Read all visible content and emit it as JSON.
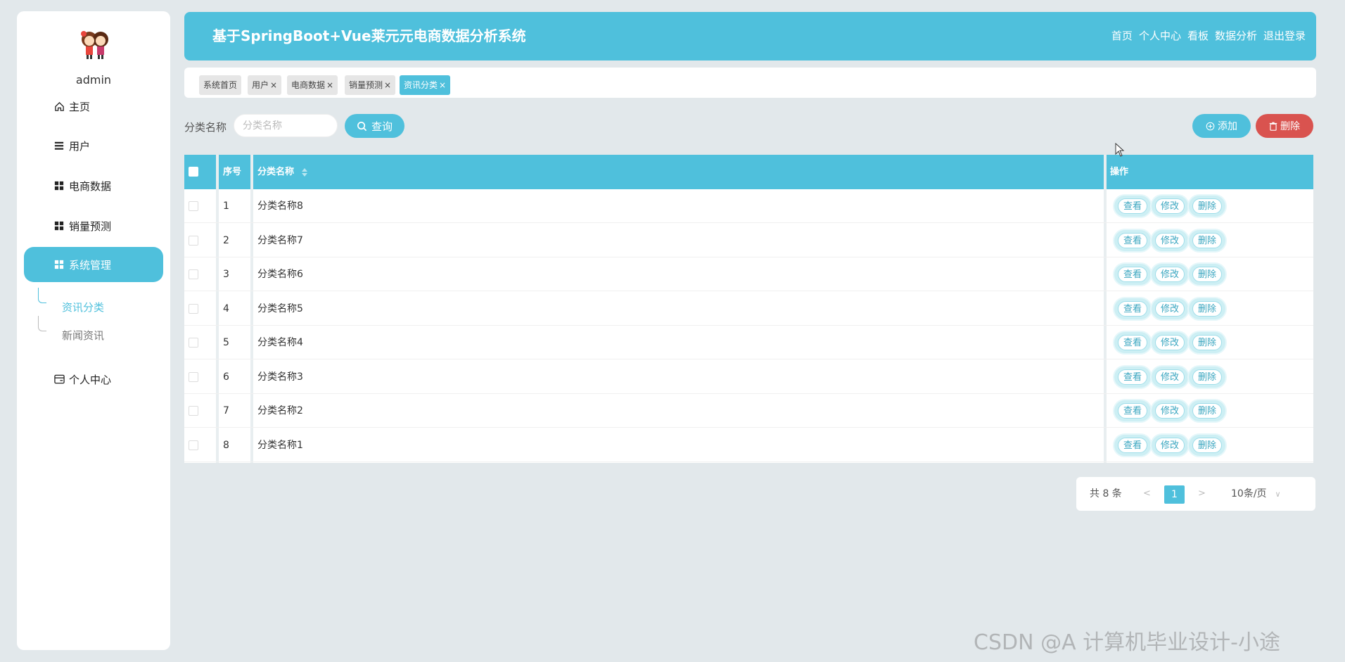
{
  "user": {
    "name": "admin"
  },
  "sidebar": {
    "items": [
      {
        "label": "主页",
        "icon": "home-icon"
      },
      {
        "label": "用户",
        "icon": "list-icon"
      },
      {
        "label": "电商数据",
        "icon": "grid-icon"
      },
      {
        "label": "销量预测",
        "icon": "grid-icon"
      },
      {
        "label": "系统管理",
        "icon": "grid-icon",
        "active": true
      },
      {
        "label": "个人中心",
        "icon": "card-icon"
      }
    ],
    "subitems": [
      {
        "label": "资讯分类",
        "active": true
      },
      {
        "label": "新闻资讯"
      }
    ]
  },
  "header": {
    "title": "基于SpringBoot+Vue莱元元电商数据分析系统",
    "nav": [
      "首页",
      "个人中心",
      "看板",
      "数据分析",
      "退出登录"
    ]
  },
  "tags": [
    {
      "label": "系统首页",
      "closable": false
    },
    {
      "label": "用户",
      "closable": true
    },
    {
      "label": "电商数据",
      "closable": true
    },
    {
      "label": "销量预测",
      "closable": true
    },
    {
      "label": "资讯分类",
      "closable": true,
      "active": true
    }
  ],
  "search": {
    "label": "分类名称",
    "placeholder": "分类名称",
    "button": "查询"
  },
  "actions": {
    "add": "添加",
    "delete": "删除"
  },
  "table": {
    "headers": {
      "index": "序号",
      "name": "分类名称",
      "ops": "操作"
    },
    "rows": [
      {
        "index": "1",
        "name": "分类名称8"
      },
      {
        "index": "2",
        "name": "分类名称7"
      },
      {
        "index": "3",
        "name": "分类名称6"
      },
      {
        "index": "4",
        "name": "分类名称5"
      },
      {
        "index": "5",
        "name": "分类名称4"
      },
      {
        "index": "6",
        "name": "分类名称3"
      },
      {
        "index": "7",
        "name": "分类名称2"
      },
      {
        "index": "8",
        "name": "分类名称1"
      }
    ],
    "row_buttons": {
      "view": "查看",
      "edit": "修改",
      "delete": "删除"
    }
  },
  "pagination": {
    "total": "共 8 条",
    "prev": "<",
    "page": "1",
    "next": ">",
    "page_size": "10条/页"
  },
  "watermark": "CSDN @A 计算机毕业设计-小途",
  "colors": {
    "accent": "#4fc0dc",
    "danger": "#d9534f",
    "background": "#e2e8eb"
  }
}
